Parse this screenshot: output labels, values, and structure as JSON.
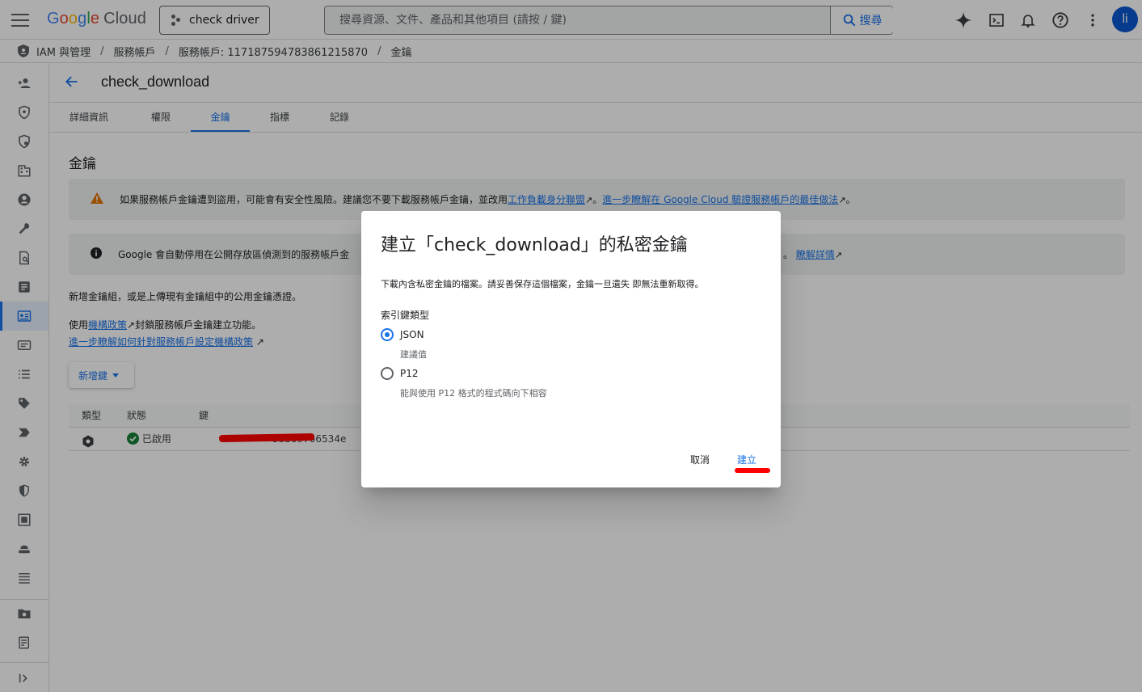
{
  "topbar": {
    "logo_parts": [
      "G",
      "o",
      "o",
      "g",
      "l",
      "e"
    ],
    "logo_cloud": "Cloud",
    "project_name": "check driver",
    "search_placeholder": "搜尋資源、文件、產品和其他項目 (請按 / 鍵)",
    "search_button": "搜尋",
    "avatar_letter": "li"
  },
  "breadcrumb": {
    "items": [
      "IAM 與管理",
      "服務帳戶",
      "服務帳戶: 117187594783861215870",
      "金鑰"
    ],
    "separator": "/"
  },
  "page": {
    "title": "check_download",
    "tabs": [
      "詳細資訊",
      "權限",
      "金鑰",
      "指標",
      "記錄"
    ],
    "active_tab": "金鑰",
    "section_title": "金鑰",
    "warning": {
      "text": "如果服務帳戶金鑰遭到盜用，可能會有安全性風險。建議您不要下載服務帳戶金鑰，並改用",
      "link1": "工作負載身分聯盟",
      "sep": "。",
      "link2": "進一步瞭解在 Google Cloud 驗證服務帳戶的最佳做法",
      "end": "。"
    },
    "info": {
      "text": "Google 會自動停用在公開存放區偵測到的服務帳戶金",
      "tail": "。",
      "link": "瞭解詳情"
    },
    "add_hint": "新增金鑰組，或是上傳現有金鑰組中的公用金鑰憑證。",
    "policy_prefix": "使用",
    "policy_link": "機構政策",
    "policy_suffix": "封鎖服務帳戶金鑰建立功能。",
    "policy_learn": "進一步瞭解如何針對服務帳戶設定機構政策",
    "add_key_button": "新增鍵",
    "table": {
      "headers": [
        "類型",
        "狀態",
        "鍵"
      ],
      "rows": [
        {
          "status": "已啟用",
          "key": "3bb09766534e"
        }
      ]
    }
  },
  "dialog": {
    "title": "建立「check_download」的私密金鑰",
    "description": "下載內含私密金鑰的檔案。請妥善保存這個檔案，金鑰一旦遺失 即無法重新取得。",
    "key_type_label": "索引鍵類型",
    "options": [
      {
        "label": "JSON",
        "hint": "建議值",
        "checked": true
      },
      {
        "label": "P12",
        "hint": "能與使用 P12 格式的程式碼向下相容",
        "checked": false
      }
    ],
    "cancel": "取消",
    "create": "建立"
  },
  "colors": {
    "accent": "#1a73e8",
    "warning": "#e37400",
    "success": "#188038",
    "redaction": "#ff0000"
  }
}
